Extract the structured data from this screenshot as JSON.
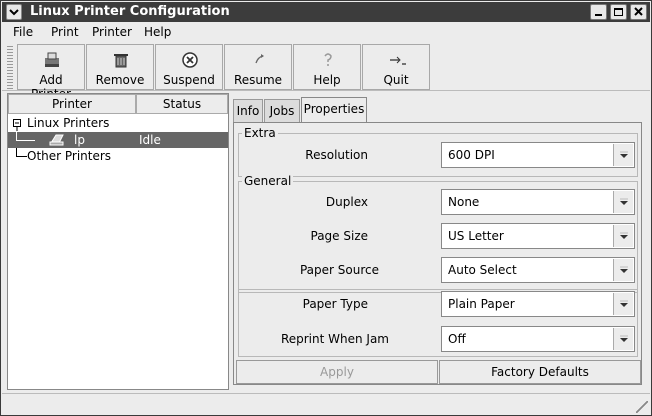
{
  "window": {
    "title": "Linux Printer Configuration"
  },
  "menubar": {
    "items": [
      "File",
      "Print",
      "Printer",
      "Help"
    ]
  },
  "toolbar": {
    "buttons": [
      {
        "label": "Add Printer",
        "icon": "printer-add-icon"
      },
      {
        "label": "Remove",
        "icon": "trash-icon"
      },
      {
        "label": "Suspend",
        "icon": "stop-icon"
      },
      {
        "label": "Resume",
        "icon": "resume-arrow-icon"
      },
      {
        "label": "Help",
        "icon": "help-icon"
      },
      {
        "label": "Quit",
        "icon": "quit-icon"
      }
    ]
  },
  "printers": {
    "columns": [
      "Printer",
      "Status"
    ],
    "groups": [
      {
        "label": "Linux Printers",
        "children": [
          {
            "name": "lp",
            "status": "Idle",
            "selected": true
          }
        ]
      },
      {
        "label": "Other Printers",
        "children": []
      }
    ]
  },
  "tabs": {
    "items": [
      "Info",
      "Jobs",
      "Properties"
    ],
    "active": "Properties"
  },
  "properties": {
    "extra_label": "Extra",
    "general_label": "General",
    "rows": [
      {
        "label": "Resolution",
        "value": "600 DPI"
      },
      {
        "label": "Duplex",
        "value": "None"
      },
      {
        "label": "Page Size",
        "value": "US Letter"
      },
      {
        "label": "Paper Source",
        "value": "Auto Select"
      },
      {
        "label": "Paper Type",
        "value": "Plain Paper"
      },
      {
        "label": "Reprint When Jam",
        "value": "Off"
      }
    ]
  },
  "buttons": {
    "apply": "Apply",
    "factory_defaults": "Factory Defaults"
  }
}
